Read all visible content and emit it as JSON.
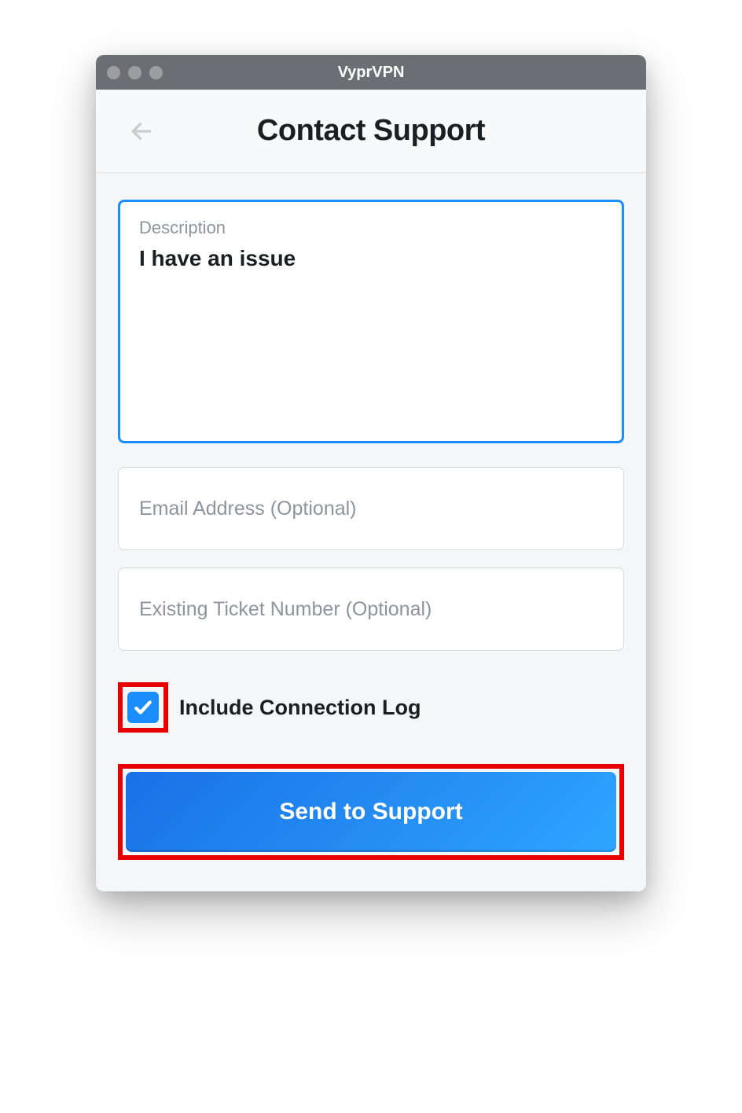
{
  "window": {
    "title": "VyprVPN"
  },
  "header": {
    "page_title": "Contact Support"
  },
  "form": {
    "description_label": "Description",
    "description_value": "I have an issue",
    "email_placeholder": "Email Address (Optional)",
    "email_value": "",
    "ticket_placeholder": "Existing Ticket Number (Optional)",
    "ticket_value": "",
    "include_log_label": "Include Connection Log",
    "include_log_checked": true,
    "submit_label": "Send to Support"
  }
}
